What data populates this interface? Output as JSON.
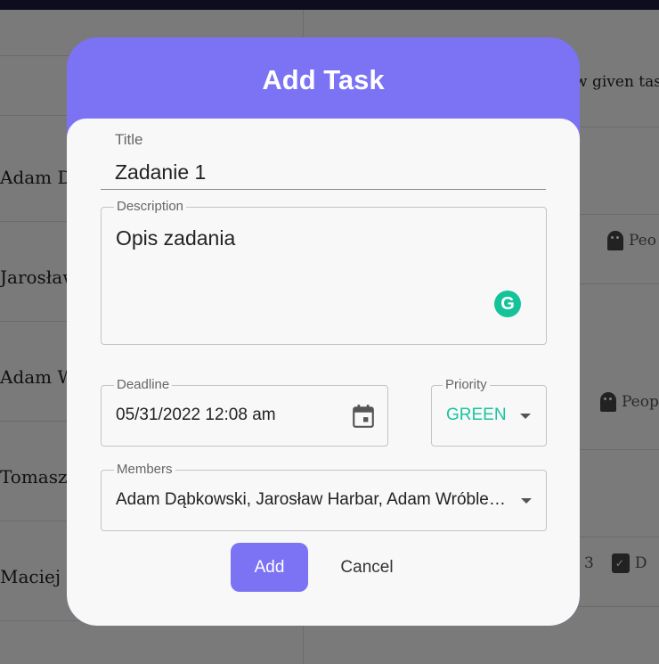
{
  "background": {
    "rows": [
      "Adam D",
      "Jarosław",
      "Adam W",
      "Tomasz",
      "Maciej  t"
    ],
    "right_header_text": "w given tas",
    "right_chips": [
      "Peo",
      "Peop",
      "3",
      "D"
    ]
  },
  "dialog": {
    "title": "Add Task",
    "title_field": {
      "label": "Title",
      "value": "Zadanie 1"
    },
    "description_field": {
      "label": "Description",
      "value": "Opis zadania"
    },
    "deadline_field": {
      "label": "Deadline",
      "value": "05/31/2022 12:08 am"
    },
    "priority_field": {
      "label": "Priority",
      "value": "GREEN"
    },
    "members_field": {
      "label": "Members",
      "value": "Adam Dąbkowski, Jarosław Harbar, Adam Wróblewski"
    },
    "add_label": "Add",
    "cancel_label": "Cancel"
  },
  "colors": {
    "accent": "#7b73f4",
    "priority_green": "#1bc4a0",
    "grammarly": "#15c39a"
  }
}
